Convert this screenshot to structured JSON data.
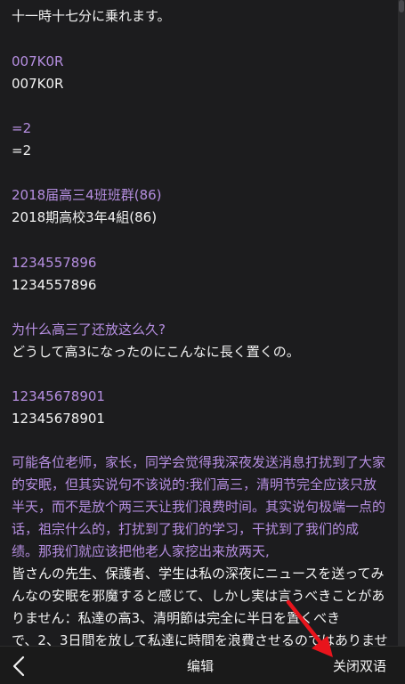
{
  "messages": [
    {
      "translated": "十一時十七分に乗れます。"
    },
    {
      "source": "007K0R",
      "translated": "007K0R"
    },
    {
      "source": "=2",
      "translated": "=2"
    },
    {
      "source": "2018届高三4班班群(86)",
      "translated": "2018期高校3年4組(86)"
    },
    {
      "source": "1234557896",
      "translated": "1234557896"
    },
    {
      "source": "为什么高三了还放这么久?",
      "translated": "どうして高3になったのにこんなに長く置くの。"
    },
    {
      "source": "12345678901",
      "translated": "12345678901"
    },
    {
      "source_lines": [
        "可能各位老师，家长，同学会觉得我深夜发送消息打扰到了大家",
        "的安眠，但其实说句不该说的:我们高三，清明节完全应该只放",
        "半天，而不是放个两三天让我们浪费时间。其实说句极端一点的",
        "话，祖宗什么的，打扰到了我们的学习，干扰到了我们的成",
        "绩。那我们就应该把他老人家挖出来放两天,"
      ],
      "translated_lines": [
        "皆さんの先生、保護者、学生は私の深夜にニュースを送ってみ",
        "んなの安眠を邪魔すると感じて、しかし実は言うべきことがあ",
        "りません：私達の高3、清明節は完全に半日を置くべき",
        "で、2、3日間を放して私達に時間を浪費させるのではありませ"
      ]
    }
  ],
  "bottom_bar": {
    "back_icon": "chevron-left-icon",
    "edit_label": "编辑",
    "close_bilingual_label": "关闭双语"
  },
  "colors": {
    "background": "#1c1c1e",
    "source_text": "#b58ee0",
    "translated_text": "#f2f2f2",
    "annotation_arrow": "#e8141c"
  }
}
